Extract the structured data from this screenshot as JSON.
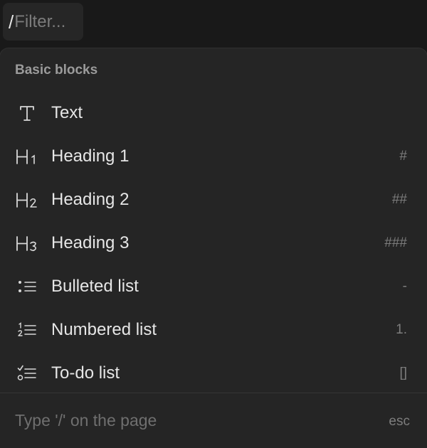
{
  "filter": {
    "prefix": "/",
    "placeholder": "Filter..."
  },
  "menu": {
    "section_title": "Basic blocks",
    "items": [
      {
        "label": "Text",
        "shortcut": "",
        "icon": "text-type-icon"
      },
      {
        "label": "Heading 1",
        "shortcut": "#",
        "icon": "heading-1-icon"
      },
      {
        "label": "Heading 2",
        "shortcut": "##",
        "icon": "heading-2-icon"
      },
      {
        "label": "Heading 3",
        "shortcut": "###",
        "icon": "heading-3-icon"
      },
      {
        "label": "Bulleted list",
        "shortcut": "-",
        "icon": "bulleted-list-icon"
      },
      {
        "label": "Numbered list",
        "shortcut": "1.",
        "icon": "numbered-list-icon"
      },
      {
        "label": "To-do list",
        "shortcut": "[]",
        "icon": "todo-list-icon"
      }
    ],
    "footer_hint": "Type '/' on the page",
    "footer_close": "esc"
  },
  "colors": {
    "background": "#191919",
    "menu_bg": "#252525",
    "text": "#e6e6e6",
    "muted": "#7d7d7d"
  }
}
